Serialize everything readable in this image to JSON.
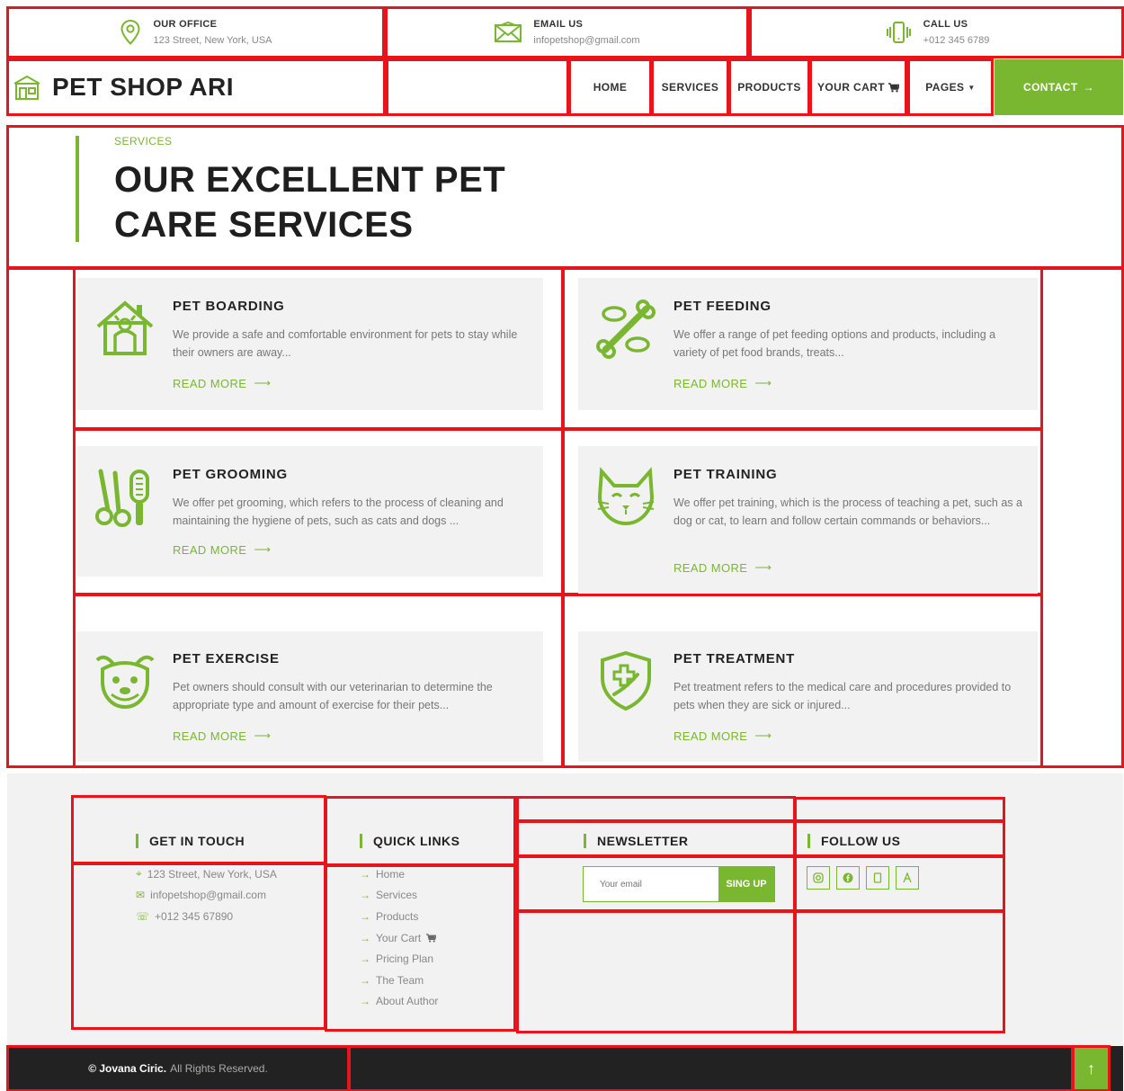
{
  "topbar": {
    "office": {
      "label": "OUR OFFICE",
      "value": "123 Street, New York, USA",
      "icon": "location-pin-icon"
    },
    "email": {
      "label": "EMAIL US",
      "value": "infopetshop@gmail.com",
      "icon": "envelope-icon"
    },
    "call": {
      "label": "CALL US",
      "value": "+012 345 6789",
      "icon": "phone-vibrate-icon"
    }
  },
  "nav": {
    "brand": "PET SHOP ARI",
    "items": [
      "HOME",
      "SERVICES",
      "PRODUCTS",
      "YOUR CART",
      "PAGES",
      "CONTACT"
    ]
  },
  "services": {
    "subtitle": "SERVICES",
    "title": "OUR EXCELLENT PET CARE SERVICES",
    "read_more": "READ MORE",
    "cards": [
      {
        "title": "PET BOARDING",
        "text": "We provide a safe and comfortable environment for pets to stay while their owners are away...",
        "icon": "pet-house-icon"
      },
      {
        "title": "PET FEEDING",
        "text": "We offer a range of pet feeding options and products, including a variety of pet food brands, treats...",
        "icon": "bone-fish-icon"
      },
      {
        "title": "PET GROOMING",
        "text": "We offer pet grooming, which refers to the process of cleaning and maintaining the hygiene of pets, such as cats and dogs ...",
        "icon": "scissors-brush-icon"
      },
      {
        "title": "PET TRAINING",
        "text": "We offer pet training, which is the process of teaching a pet, such as a dog or cat, to learn and follow certain commands or behaviors...",
        "icon": "cat-face-icon"
      },
      {
        "title": "PET EXERCISE",
        "text": "Pet owners should consult with our veterinarian to determine the appropriate type and amount of exercise for their pets...",
        "icon": "dog-face-icon"
      },
      {
        "title": "PET TREATMENT",
        "text": "Pet treatment refers to the medical care and procedures provided to pets when they are sick or injured...",
        "icon": "medical-shield-icon"
      }
    ]
  },
  "footer": {
    "contact": {
      "title": "GET IN TOUCH",
      "address": "123 Street, New York, USA",
      "email": "infopetshop@gmail.com",
      "phone": "+012 345 67890"
    },
    "links": {
      "title": "QUICK LINKS",
      "items": [
        "Home",
        "Services",
        "Products",
        "Your Cart",
        "Pricing Plan",
        "The Team",
        "About Author"
      ]
    },
    "newsletter": {
      "title": "NEWSLETTER",
      "placeholder": "Your email",
      "button": "SING UP"
    },
    "follow": {
      "title": "FOLLOW US",
      "icons": [
        "instagram-icon",
        "facebook-icon",
        "file-icon",
        "a-icon"
      ]
    },
    "copyright": {
      "name": "© Jovana Ciric.",
      "text": "All Rights Reserved."
    }
  },
  "colors": {
    "accent": "#7ab730",
    "outline": "#e8141c",
    "dark": "#222222"
  }
}
